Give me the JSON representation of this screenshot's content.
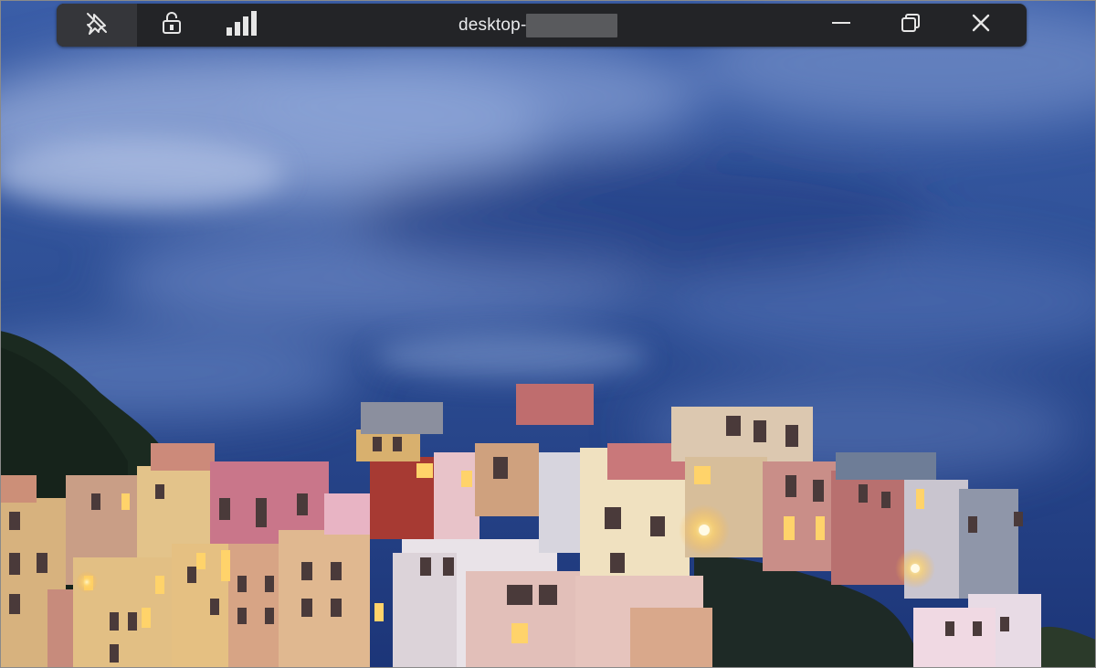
{
  "remote_bar": {
    "title": "desktop-",
    "icons": {
      "pin": "pin-off-icon",
      "lock": "unlocked-padlock-icon",
      "signal": "connection-strength-icon",
      "minimize": "minimize-icon",
      "restore": "restore-icon",
      "close": "close-icon"
    },
    "signal_level": 1.0
  },
  "desktop": {
    "wallpaper": "hillside-village-dusk-icon"
  },
  "colors": {
    "bar_background": "#232427",
    "bar_active": "#35363a",
    "sky_top": "#3a5898",
    "sky_bottom": "#1f3a7a"
  }
}
